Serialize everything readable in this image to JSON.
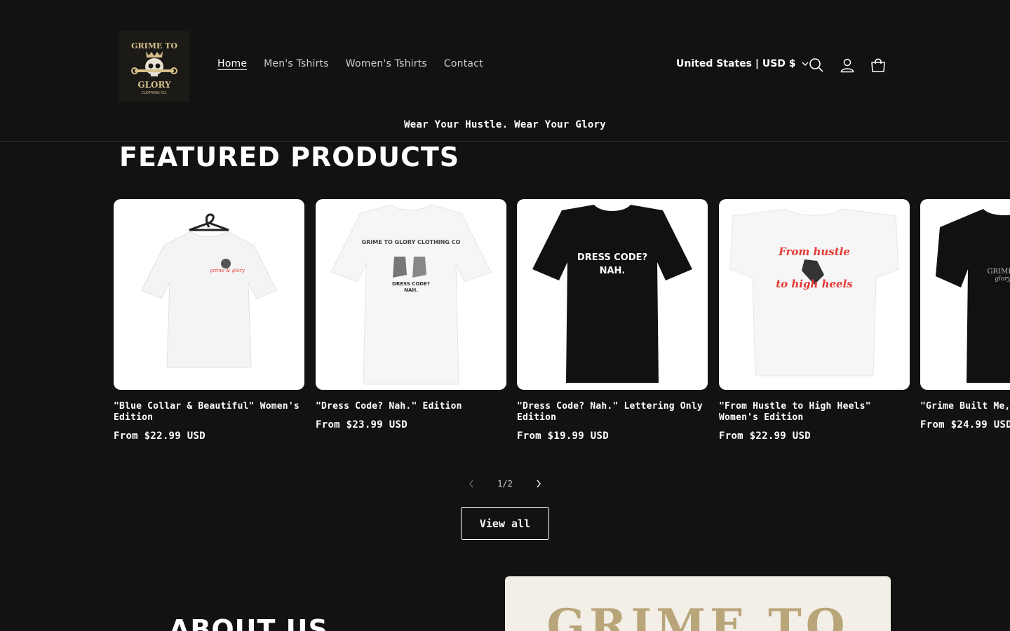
{
  "header": {
    "logo": {
      "lines": [
        "GRIME TO",
        "GLORY",
        "CLOTHING CO."
      ],
      "icon": "skull-crown-wrench-icon"
    },
    "nav": [
      {
        "label": "Home",
        "active": true
      },
      {
        "label": "Men's Tshirts",
        "active": false
      },
      {
        "label": "Women's Tshirts",
        "active": false
      },
      {
        "label": "Contact",
        "active": false
      }
    ],
    "country_selector": "United States | USD $",
    "icons": [
      "search-icon",
      "account-icon",
      "cart-icon"
    ],
    "tagline": "Wear Your Hustle. Wear Your Glory"
  },
  "featured": {
    "title": "FEATURED PRODUCTS",
    "products": [
      {
        "title": "\"Blue Collar & Beautiful\" Women's Edition",
        "price": "From $22.99 USD",
        "shirt_color": "#ffffff",
        "print": "skull-logo",
        "image_text": ""
      },
      {
        "title": "\"Dress Code? Nah.\" Edition",
        "price": "From $23.99 USD",
        "shirt_color": "#ffffff",
        "print": "boots-logo",
        "image_text": "GRIME TO GLORY CLOTHING CO · DRESS CODE? NAH."
      },
      {
        "title": "\"Dress Code? Nah.\" Lettering Only Edition",
        "price": "From $19.99 USD",
        "shirt_color": "#111111",
        "print": "lettering",
        "image_text": "DRESS CODE? NAH."
      },
      {
        "title": "\"From Hustle to High Heels\" Women's Edition",
        "price": "From $22.99 USD",
        "shirt_color": "#ffffff",
        "print": "heels-script",
        "image_text": "From hustle to high heels"
      },
      {
        "title": "\"Grime Built Me, Glory Edition",
        "price": "From $24.99 USD",
        "shirt_color": "#111111",
        "print": "script",
        "image_text": "GRIME glory"
      }
    ],
    "slider": {
      "current": "1",
      "total": "2",
      "counter": "1/2"
    },
    "view_all": "View all"
  },
  "about": {
    "title": "ABOUT US",
    "image_text": "GRIME TO"
  },
  "colors": {
    "background": "#121212",
    "text": "#ffffff",
    "logo_gold": "#d8c08a",
    "accent_red": "#e53935"
  }
}
